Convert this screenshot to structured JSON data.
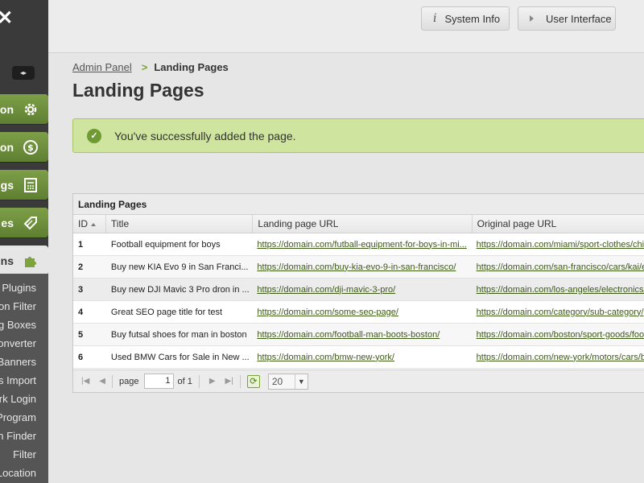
{
  "sidebar": {
    "categories": [
      {
        "label": "on",
        "icon": "gear-icon"
      },
      {
        "label": "on",
        "icon": "dollar-icon"
      },
      {
        "label": "gs",
        "icon": "calculator-icon"
      },
      {
        "label": "es",
        "icon": "tag-icon"
      },
      {
        "label": "ins",
        "icon": "puzzle-icon"
      }
    ],
    "sub_items": [
      "Plugins",
      "on Filter",
      "g Boxes",
      "onverter",
      "Banners",
      "s Import",
      "rk Login",
      "Program",
      "n Finder",
      "Filter",
      "Location"
    ]
  },
  "topbar": {
    "system_info": "System Info",
    "user_interface": "User Interface"
  },
  "breadcrumb": {
    "home": "Admin Panel",
    "separator": ">",
    "current": "Landing Pages"
  },
  "page_title": "Landing Pages",
  "success_message": "You've successfully added the page.",
  "grid": {
    "title": "Landing Pages",
    "columns": [
      "ID",
      "Title",
      "Landing page URL",
      "Original page URL"
    ],
    "rows": [
      {
        "id": "1",
        "title": "Football equipment for boys",
        "landing_url": "https://domain.com/futball-equipment-for-boys-in-mi...",
        "original_url": "https://domain.com/miami/sport-clothes/chi"
      },
      {
        "id": "2",
        "title": "Buy new KIA Evo 9 in San Franci...",
        "landing_url": "https://domain.com/buy-kia-evo-9-in-san-francisco/",
        "original_url": "https://domain.com/san-francisco/cars/kai/e"
      },
      {
        "id": "3",
        "title": "Buy new DJI Mavic 3 Pro dron in ...",
        "landing_url": "https://domain.com/dji-mavic-3-pro/",
        "original_url": "https://domain.com/los-angeles/electronics/"
      },
      {
        "id": "4",
        "title": "Great SEO page title for test",
        "landing_url": "https://domain.com/some-seo-page/",
        "original_url": "https://domain.com/category/sub-category/"
      },
      {
        "id": "5",
        "title": "Buy futsal shoes for man in boston",
        "landing_url": "https://domain.com/football-man-boots-boston/",
        "original_url": "https://domain.com/boston/sport-goods/foo"
      },
      {
        "id": "6",
        "title": "Used BMW Cars for Sale in New ...",
        "landing_url": "https://domain.com/bmw-new-york/",
        "original_url": "https://domain.com/new-york/motors/cars/b"
      }
    ],
    "pager": {
      "page_label": "page",
      "page_value": "1",
      "of_label": "of 1",
      "per_page": "20"
    }
  }
}
